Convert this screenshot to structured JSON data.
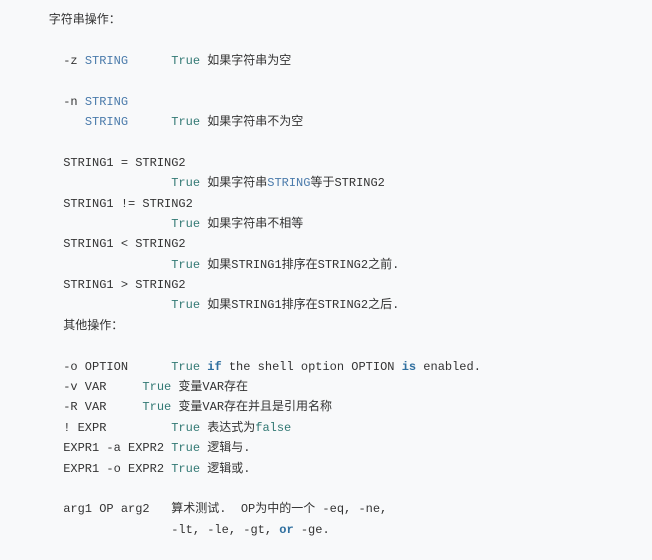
{
  "lines": [
    {
      "segs": [
        {
          "t": "    字符串操作：",
          "c": ""
        }
      ]
    },
    {
      "segs": [
        {
          "t": "",
          "c": ""
        }
      ]
    },
    {
      "segs": [
        {
          "t": "      -z ",
          "c": ""
        },
        {
          "t": "STRING",
          "c": "str"
        },
        {
          "t": "      ",
          "c": ""
        },
        {
          "t": "True",
          "c": "t"
        },
        {
          "t": " 如果字符串为空",
          "c": ""
        }
      ]
    },
    {
      "segs": [
        {
          "t": "",
          "c": ""
        }
      ]
    },
    {
      "segs": [
        {
          "t": "      -n ",
          "c": ""
        },
        {
          "t": "STRING",
          "c": "str"
        }
      ]
    },
    {
      "segs": [
        {
          "t": "         ",
          "c": ""
        },
        {
          "t": "STRING",
          "c": "str"
        },
        {
          "t": "      ",
          "c": ""
        },
        {
          "t": "True",
          "c": "t"
        },
        {
          "t": " 如果字符串不为空",
          "c": ""
        }
      ]
    },
    {
      "segs": [
        {
          "t": "",
          "c": ""
        }
      ]
    },
    {
      "segs": [
        {
          "t": "      STRING1 = STRING2",
          "c": ""
        }
      ]
    },
    {
      "segs": [
        {
          "t": "                     ",
          "c": ""
        },
        {
          "t": "True",
          "c": "t"
        },
        {
          "t": " 如果字符串",
          "c": ""
        },
        {
          "t": "STRING",
          "c": "str"
        },
        {
          "t": "等于STRING2",
          "c": ""
        }
      ]
    },
    {
      "segs": [
        {
          "t": "      STRING1 != STRING2",
          "c": ""
        }
      ]
    },
    {
      "segs": [
        {
          "t": "                     ",
          "c": ""
        },
        {
          "t": "True",
          "c": "t"
        },
        {
          "t": " 如果字符串不相等",
          "c": ""
        }
      ]
    },
    {
      "segs": [
        {
          "t": "      STRING1 < STRING2",
          "c": ""
        }
      ]
    },
    {
      "segs": [
        {
          "t": "                     ",
          "c": ""
        },
        {
          "t": "True",
          "c": "t"
        },
        {
          "t": " 如果STRING1排序在STRING2之前.",
          "c": ""
        }
      ]
    },
    {
      "segs": [
        {
          "t": "      STRING1 > STRING2",
          "c": ""
        }
      ]
    },
    {
      "segs": [
        {
          "t": "                     ",
          "c": ""
        },
        {
          "t": "True",
          "c": "t"
        },
        {
          "t": " 如果STRING1排序在STRING2之后.",
          "c": ""
        }
      ]
    },
    {
      "segs": [
        {
          "t": "      其他操作：",
          "c": ""
        }
      ]
    },
    {
      "segs": [
        {
          "t": "",
          "c": ""
        }
      ]
    },
    {
      "segs": [
        {
          "t": "      -o OPTION      ",
          "c": ""
        },
        {
          "t": "True",
          "c": "t"
        },
        {
          "t": " ",
          "c": ""
        },
        {
          "t": "if",
          "c": "kw2"
        },
        {
          "t": " the shell option OPTION ",
          "c": ""
        },
        {
          "t": "is",
          "c": "kw2"
        },
        {
          "t": " enabled.",
          "c": ""
        }
      ]
    },
    {
      "segs": [
        {
          "t": "      -v VAR     ",
          "c": ""
        },
        {
          "t": "True",
          "c": "t"
        },
        {
          "t": " 变量VAR存在",
          "c": ""
        }
      ]
    },
    {
      "segs": [
        {
          "t": "      -R VAR     ",
          "c": ""
        },
        {
          "t": "True",
          "c": "t"
        },
        {
          "t": " 变量VAR存在并且是引用名称",
          "c": ""
        }
      ]
    },
    {
      "segs": [
        {
          "t": "      ! EXPR         ",
          "c": ""
        },
        {
          "t": "True",
          "c": "t"
        },
        {
          "t": " 表达式为",
          "c": ""
        },
        {
          "t": "false",
          "c": "t"
        }
      ]
    },
    {
      "segs": [
        {
          "t": "      EXPR1 -a EXPR2 ",
          "c": ""
        },
        {
          "t": "True",
          "c": "t"
        },
        {
          "t": " 逻辑与.",
          "c": ""
        }
      ]
    },
    {
      "segs": [
        {
          "t": "      EXPR1 -o EXPR2 ",
          "c": ""
        },
        {
          "t": "True",
          "c": "t"
        },
        {
          "t": " 逻辑或.",
          "c": ""
        }
      ]
    },
    {
      "segs": [
        {
          "t": "",
          "c": ""
        }
      ]
    },
    {
      "segs": [
        {
          "t": "      arg1 OP arg2   算术测试.  OP为中的一个 -eq, -ne,",
          "c": ""
        }
      ]
    },
    {
      "segs": [
        {
          "t": "                     -lt, -le, -gt, ",
          "c": ""
        },
        {
          "t": "or",
          "c": "kw2"
        },
        {
          "t": " -ge.",
          "c": ""
        }
      ]
    }
  ]
}
